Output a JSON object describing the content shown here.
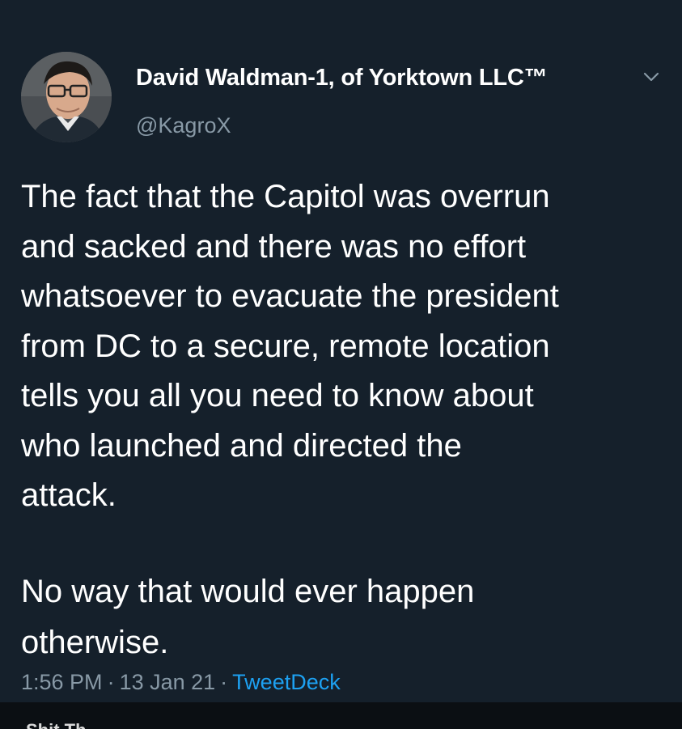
{
  "tweet": {
    "author_name": "David Waldman-1, of Yorktown LLC™",
    "author_handle": "@KagroX",
    "avatar_icon": "person-avatar",
    "menu_icon": "chevron-down-icon",
    "body_paragraph_1": "The fact that the Capitol was overrun\nand sacked and there was no effort\nwhatsoever to evacuate the president\nfrom DC to a secure, remote location\ntells you all you need to know about\nwho launched and directed the\nattack.",
    "body_paragraph_2": "No way that would ever happen\notherwise.",
    "time": "1:56 PM",
    "date": "13 Jan 21",
    "separator": "·",
    "source": "TweetDeck"
  },
  "bottom_bar": {
    "partial_text": "Shit Th"
  },
  "colors": {
    "background": "#15202b",
    "text": "#ffffff",
    "muted": "#8899a6",
    "link": "#1da1f2"
  }
}
